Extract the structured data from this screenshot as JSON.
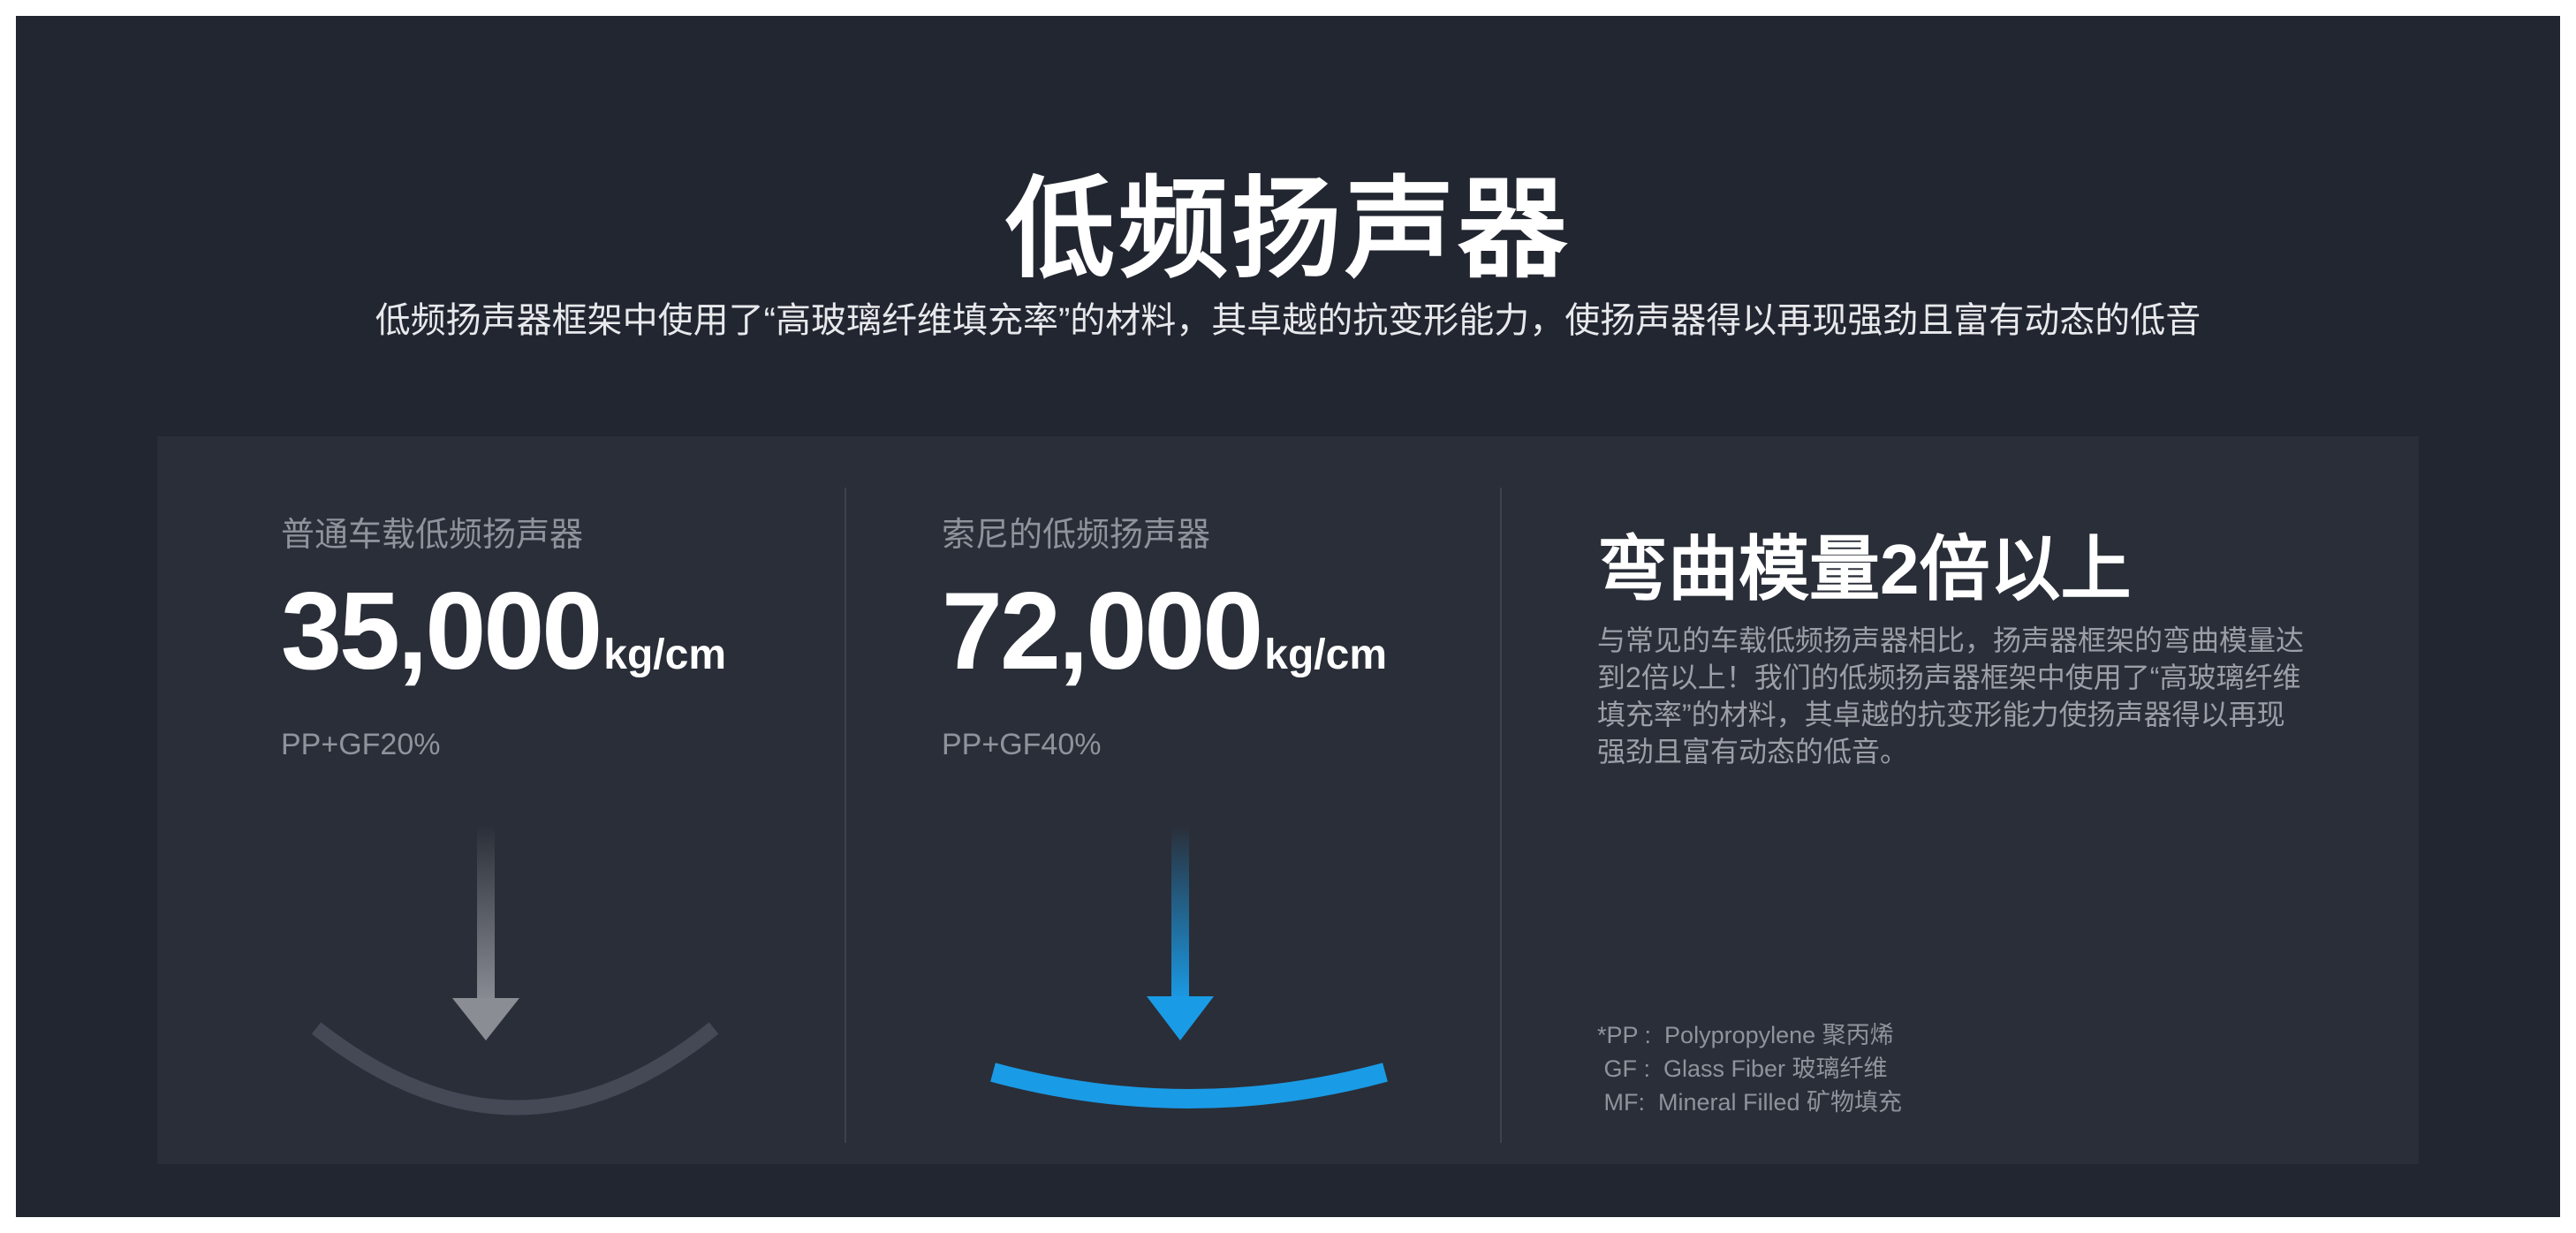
{
  "header": {
    "title": "低频扬声器",
    "subtitle": "低频扬声器框架中使用了“高玻璃纤维填充率”的材料，其卓越的抗变形能力，使扬声器得以再现强劲且富有动态的低音"
  },
  "comparison": [
    {
      "label": "普通车载低频扬声器",
      "value": "35,000",
      "unit": "kg/cm",
      "material": "PP+GF20%",
      "arrow_color": "#8a8d93",
      "curve_color": "#454855"
    },
    {
      "label": "索尼的低频扬声器",
      "value": "72,000",
      "unit": "kg/cm",
      "material": "PP+GF40%",
      "arrow_color": "#1a9be6",
      "curve_color": "#1a9be6"
    }
  ],
  "feature": {
    "title": "弯曲模量2倍以上",
    "description": "与常见的车载低频扬声器相比，扬声器框架的弯曲模量达到2倍以上！我们的低频扬声器框架中使用了“高玻璃纤维填充率”的材料，其卓越的抗变形能力使扬声器得以再现强劲且富有动态的低音。"
  },
  "footnotes": [
    "*PP :  Polypropylene 聚丙烯",
    " GF :  Glass Fiber 玻璃纤维",
    " MF:  Mineral Filled 矿物填充"
  ],
  "colors": {
    "background": "#222631",
    "panel": "#2a2e38",
    "accent": "#1a9be6"
  }
}
